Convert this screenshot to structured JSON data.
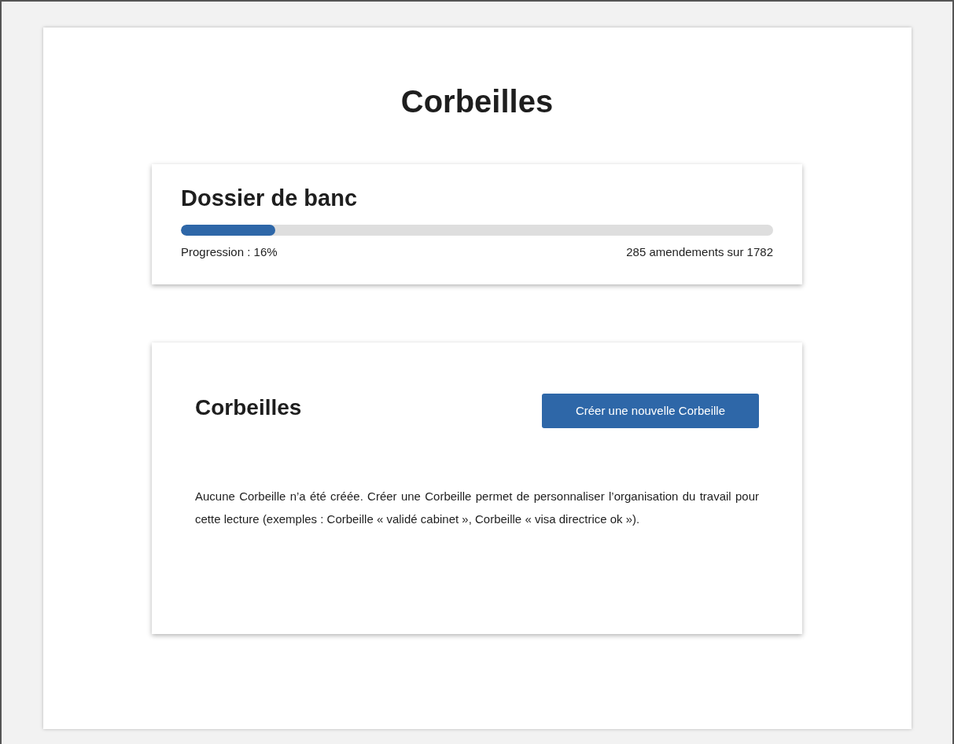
{
  "page": {
    "title": "Corbeilles"
  },
  "progress_card": {
    "title": "Dossier de banc",
    "level": 0.16,
    "progress_label": "Progression : 16%",
    "count_label": "285 amendements sur 1782"
  },
  "baskets_card": {
    "title": "Corbeilles",
    "create_button": "Créer une nouvelle Corbeille",
    "empty_message": "Aucune Corbeille n’a été créée. Créer une Corbeille permet de personnaliser l’organisation du travail pour cette lecture (exemples : Corbeille « validé cabinet », Corbeille « visa directrice ok »)."
  }
}
